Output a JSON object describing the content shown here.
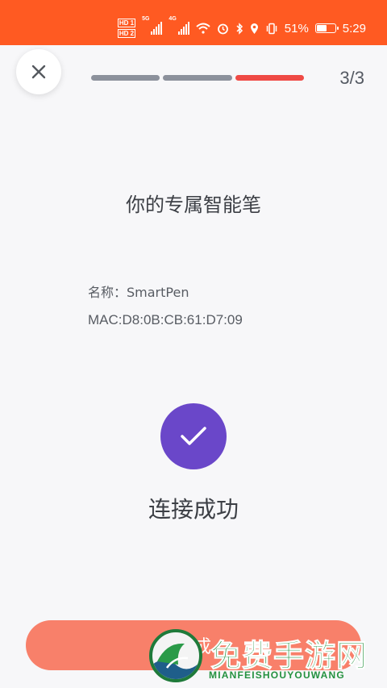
{
  "status_bar": {
    "background": "#ff5a22",
    "sim1_label": "HD 1",
    "sim2_label": "HD 2",
    "network1": "5G",
    "network2": "4G",
    "icons": [
      "wifi-icon",
      "alarm-icon",
      "bluetooth-icon",
      "location-icon",
      "vibrate-icon"
    ],
    "battery_percent": "51%",
    "battery_level": 0.51,
    "time": "5:29"
  },
  "header": {
    "close_icon": "close-icon",
    "progress": {
      "total_steps": 3,
      "current_step": 3,
      "done_color": "#8c919c",
      "current_color": "#ef4a45"
    },
    "step_counter": "3/3"
  },
  "main": {
    "title": "你的专属智能笔",
    "device_name": "名称：SmartPen",
    "device_mac": "MAC:D8:0B:CB:61:D7:09",
    "success_icon": "check-icon",
    "success_color": "#6a47c9",
    "success_text": "连接成功"
  },
  "footer": {
    "button_label": "完成",
    "button_color": "#f8806a"
  },
  "watermark": {
    "text": "免费手游网",
    "subtext": "MIANFEISHOUYOUWANG"
  }
}
